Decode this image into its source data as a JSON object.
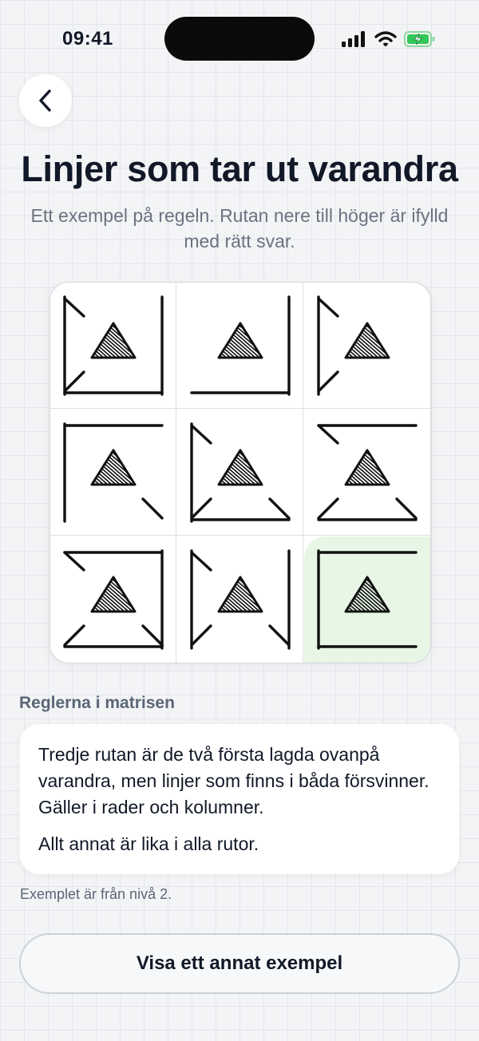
{
  "status_bar": {
    "time": "09:41",
    "icons": [
      "signal-icon",
      "wifi-icon",
      "battery-charging-icon"
    ],
    "battery_color": "#34c759"
  },
  "nav": {
    "back_icon": "chevron-left-icon"
  },
  "header": {
    "title": "Linjer som tar ut varandra",
    "subtitle": "Ett exempel på regeln. Rutan nere till höger är ifylld med rätt svar."
  },
  "matrix": {
    "rows": 3,
    "cols": 3,
    "answer_cell": "row 3, column 3",
    "answer_highlight": "#e7f6e5",
    "cell_symbol": "hatched-triangle"
  },
  "rules": {
    "heading": "Reglerna i matrisen",
    "paragraphs": [
      "Tredje rutan är de två första lagda ovanpå varandra, men linjer som finns i båda försvinner. Gäller i rader och kolumner.",
      "Allt annat är lika i alla rutor."
    ]
  },
  "footnote": "Exemplet är från nivå 2.",
  "cta": {
    "label": "Visa ett annat exempel"
  }
}
